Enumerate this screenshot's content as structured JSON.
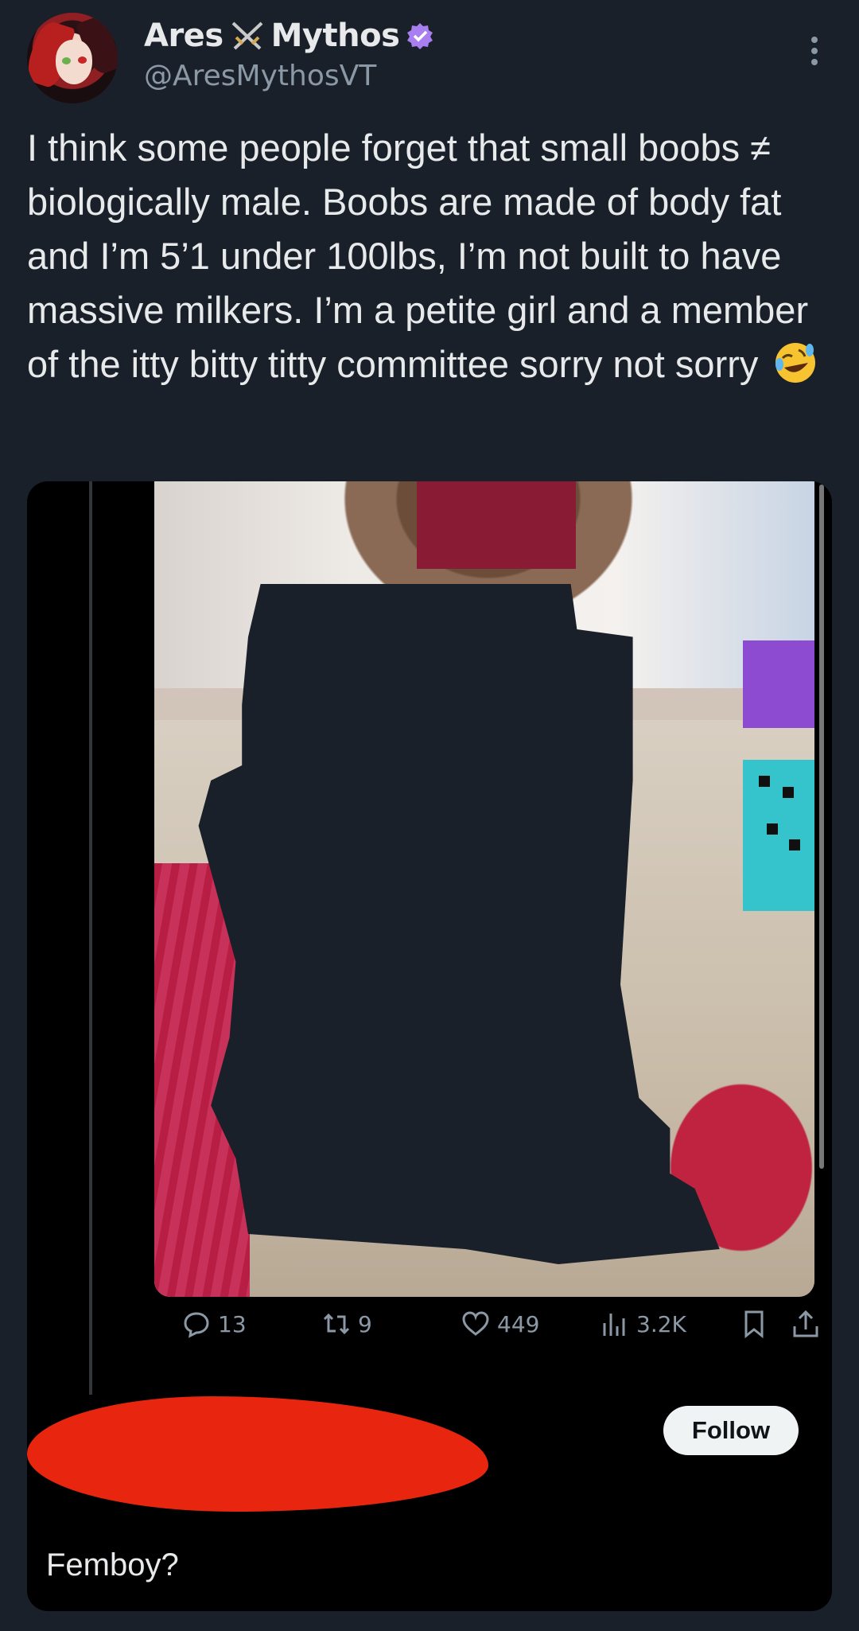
{
  "author": {
    "name_part1": "Ares",
    "name_part2": "Mythos",
    "handle": "@AresMythosVT",
    "verified": true
  },
  "post": {
    "text": "I think some people forget that small boobs ≠ biologically male. Boobs are made of body fat and I’m 5’1 under 100lbs, I’m not built to have massive milkers. I’m a petite girl and a member of the itty bitty titty committee sorry not sorry",
    "emoji": "rolling-on-floor-laughing"
  },
  "quoted": {
    "actions": {
      "replies": "13",
      "reposts": "9",
      "likes": "449",
      "views": "3.2K"
    },
    "follow_label": "Follow",
    "reply_text": "Femboy?"
  },
  "colors": {
    "background": "#19202a",
    "text": "#e7e9ea",
    "muted": "#8b98a5",
    "verified": "#a97ef0",
    "scribble": "#e8250f"
  }
}
